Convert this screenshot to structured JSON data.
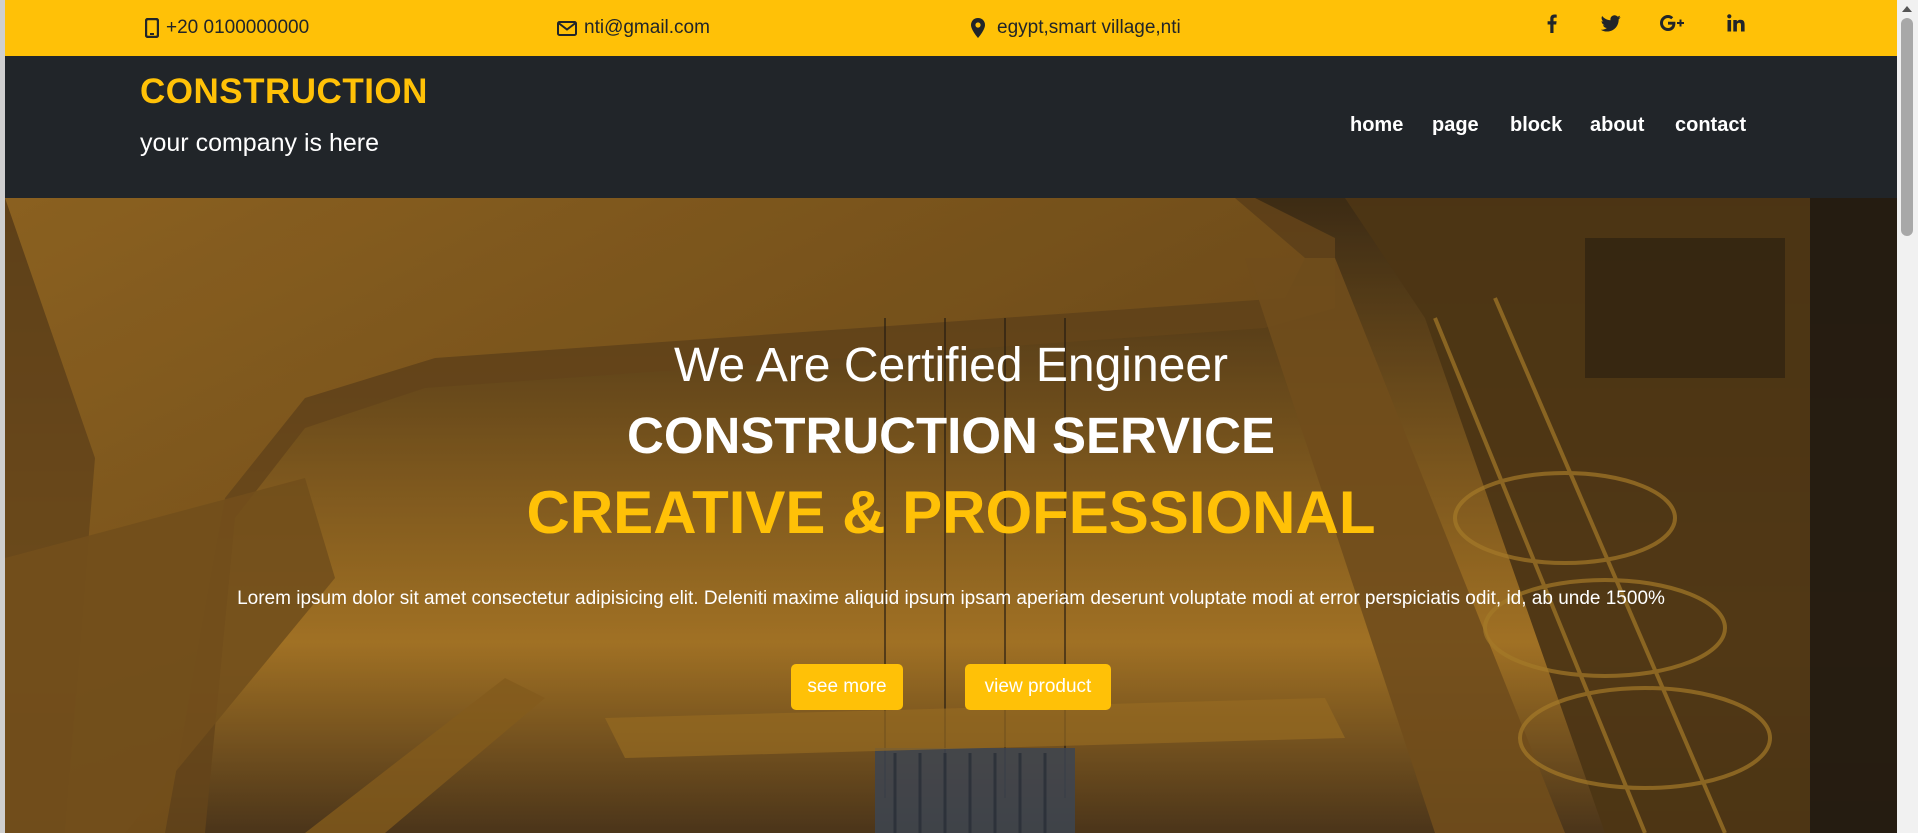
{
  "topbar": {
    "phone": "+20 0100000000",
    "email": "nti@gmail.com",
    "location": "egypt,smart village,nti",
    "phone_icon": "mobile-phone-icon",
    "email_icon": "envelope-icon",
    "location_icon": "map-pin-icon",
    "social": [
      "facebook-icon",
      "twitter-icon",
      "google-plus-icon",
      "linkedin-icon"
    ]
  },
  "header": {
    "brand": "CONSTRUCTION",
    "tagline": "your company is here",
    "nav": [
      "home",
      "page",
      "block",
      "about",
      "contact"
    ]
  },
  "hero": {
    "line1": "We Are Certified Engineer",
    "line2": "CONSTRUCTION SERVICE",
    "line3": "CREATIVE & PROFESSIONAL",
    "text": "Lorem ipsum dolor sit amet consectetur adipisicing elit. Deleniti maxime aliquid ipsum ipsam aperiam deserunt voluptate modi at error perspiciatis odit, id, ab unde 1500%",
    "buttons": [
      "see more",
      "view product"
    ]
  },
  "colors": {
    "accent": "#ffc107",
    "header_bg": "#212529",
    "text_light": "#ffffff"
  }
}
